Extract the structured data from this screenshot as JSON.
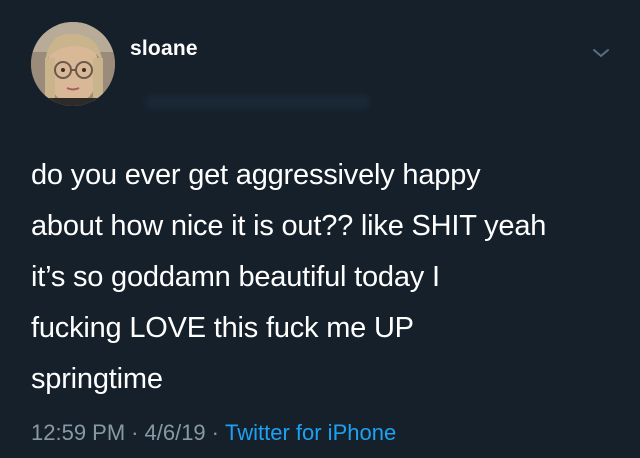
{
  "user": {
    "display_name": "sloane",
    "avatar_icon": "profile-photo"
  },
  "tweet": {
    "lines": [
      "do you ever get aggressively happy",
      "about how nice it is out?? like SHIT yeah",
      "it’s so goddamn beautiful today I",
      "fucking LOVE this fuck me UP",
      "springtime"
    ],
    "time": "12:59 PM",
    "separator": "·",
    "date": "4/6/19",
    "source": "Twitter for iPhone"
  },
  "menu": {
    "icon": "chevron-down-icon"
  },
  "colors": {
    "background": "#15202b",
    "text": "#ffffff",
    "meta": "#8899a6",
    "link": "#1da1f2"
  }
}
